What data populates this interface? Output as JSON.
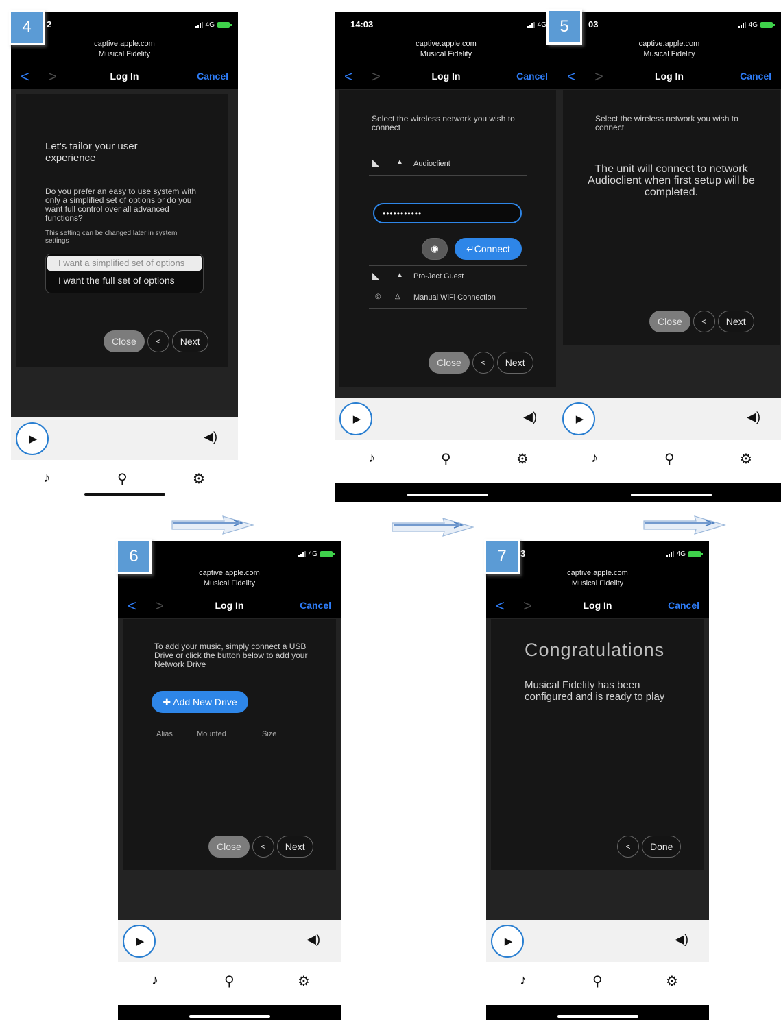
{
  "steps": {
    "s4": "4",
    "s5": "5",
    "s6": "6",
    "s7": "7"
  },
  "common": {
    "url": "captive.apple.com",
    "site": "Musical Fidelity",
    "nav_title": "Log In",
    "cancel": "Cancel",
    "back": "<",
    "forward": ">",
    "network": "4G",
    "btn_close": "Close",
    "btn_prev": "<",
    "btn_next": "Next",
    "btn_done": "Done",
    "play_icon": "play-icon",
    "volume_icon": "volume-icon"
  },
  "status_times": {
    "p4": "2",
    "p5a": "14:03",
    "p5b": "03",
    "p7": "3"
  },
  "step4": {
    "heading": "Let's tailor your user experience",
    "question": "Do you prefer an easy to use system with only a simplified set of options or do you want full control over all advanced functions?",
    "note": "This setting can be changed later in system settings",
    "option_simple": "I want a simplified set of options",
    "option_full": "I want the full set of options"
  },
  "step5": {
    "prompt": "Select the wireless network you wish to connect",
    "networks": [
      {
        "name": "Audioclient",
        "icon": "wifi-icon",
        "lock": "lock-icon"
      },
      {
        "name": "Pro-Ject Guest",
        "icon": "wifi-icon",
        "lock": "lock-icon"
      },
      {
        "name": "Manual WiFi Connection",
        "icon": "eye-off-icon",
        "lock": "unlock-icon"
      }
    ],
    "password": "•••••••••••",
    "connect": "Connect",
    "confirm": "The unit will connect to network Audioclient when first setup will be completed."
  },
  "step6": {
    "text": "To add your music, simply connect a USB Drive or click the button below to add your Network Drive",
    "add_drive": "Add New Drive",
    "columns": [
      "Alias",
      "Mounted",
      "Size"
    ]
  },
  "step7": {
    "title": "Congratulations",
    "text": "Musical Fidelity has been configured and is ready to play"
  },
  "colors": {
    "accent_blue": "#2e7cf6",
    "badge_blue": "#5b9bd5",
    "battery_green": "#3fd14b"
  }
}
